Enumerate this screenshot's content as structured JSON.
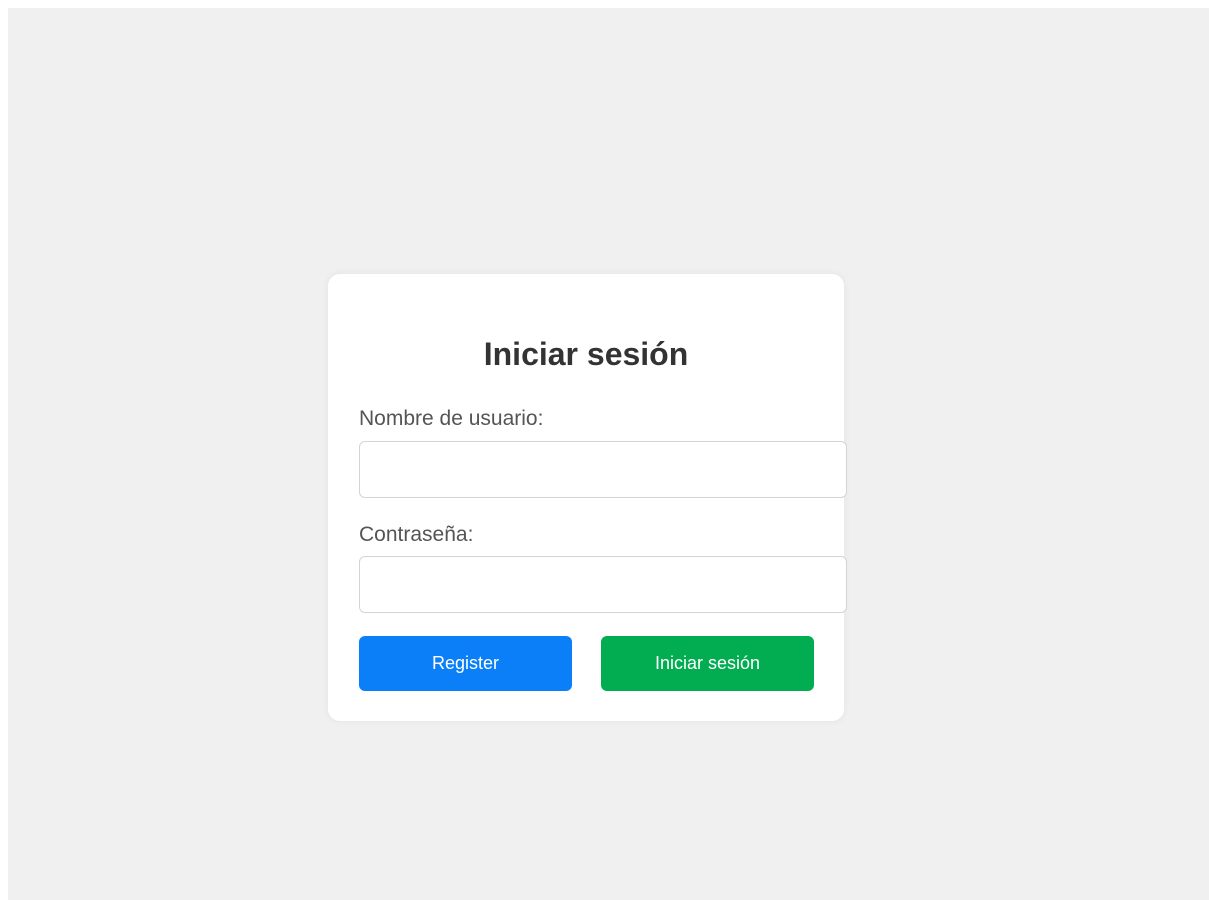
{
  "login": {
    "title": "Iniciar sesión",
    "username_label": "Nombre de usuario:",
    "username_value": "",
    "password_label": "Contraseña:",
    "password_value": "",
    "register_button": "Register",
    "login_button": "Iniciar sesión"
  },
  "colors": {
    "page_background": "#f0f0f0",
    "card_background": "#ffffff",
    "register_button": "#0a7ff7",
    "login_button": "#02ad51",
    "title_text": "#333333",
    "label_text": "#555555"
  }
}
